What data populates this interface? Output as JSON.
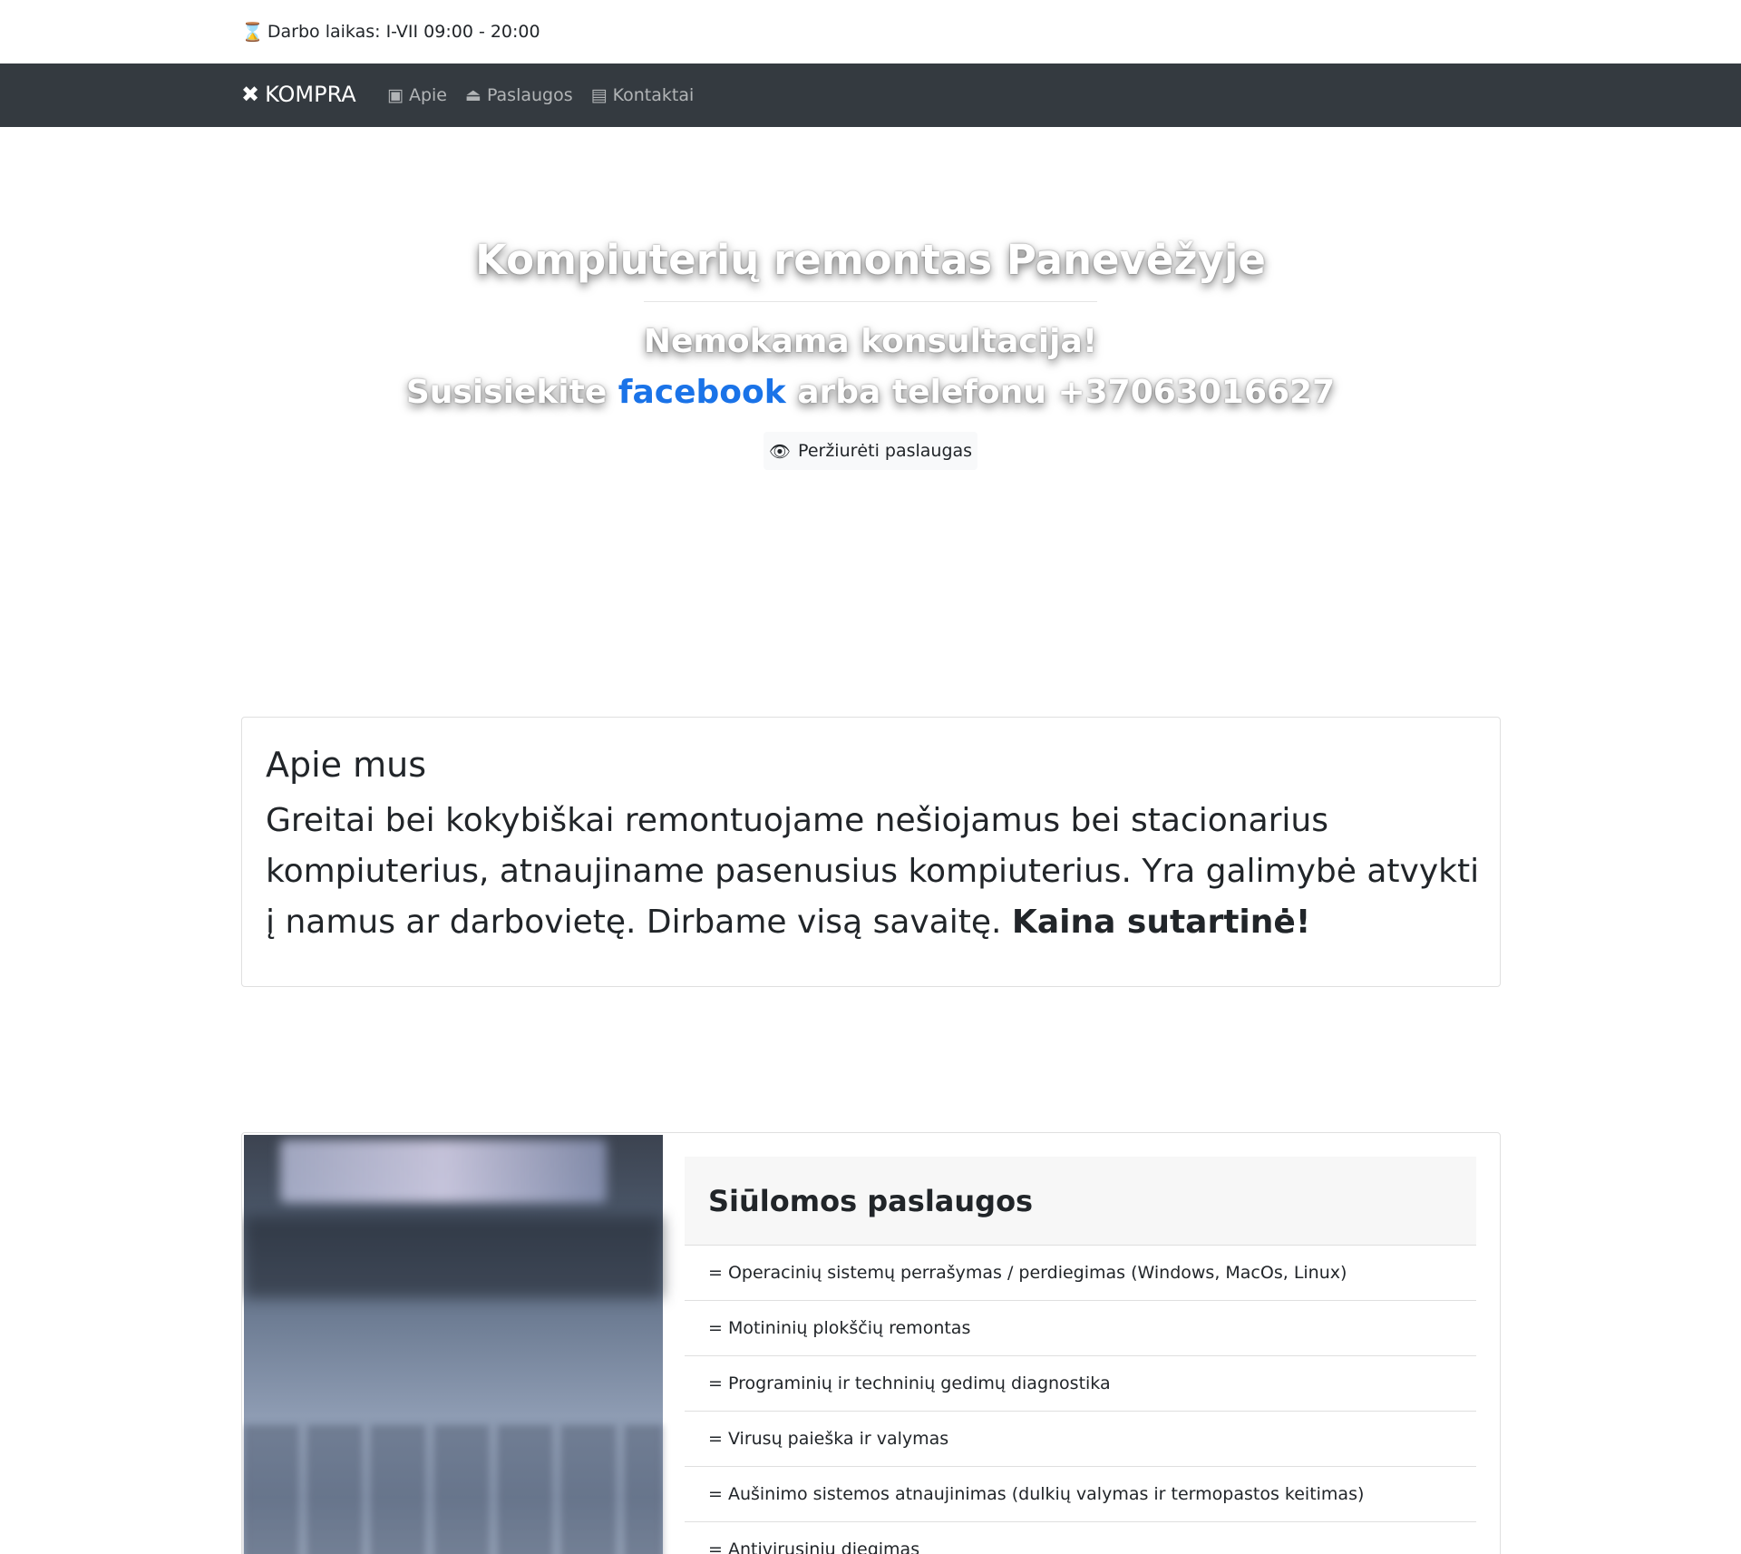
{
  "topbar": {
    "hours_icon": "hourglass-icon",
    "hours_text": "Darbo laikas: I-VII 09:00 - 20:00"
  },
  "navbar": {
    "brand_icon": "tools-icon",
    "brand": "KOMPRA",
    "items": [
      {
        "icon": "id-card-icon",
        "label": "Apie"
      },
      {
        "icon": "service-bell-icon",
        "label": "Paslaugos"
      },
      {
        "icon": "address-book-icon",
        "label": "Kontaktai"
      }
    ],
    "bg_color": "#343a40"
  },
  "hero": {
    "title": "Kompiuterių remontas Panevėžyje",
    "subtitle": "Nemokama konsultacija!",
    "contact_prefix": "Susisiekite",
    "contact_link": "facebook",
    "contact_suffix": "arba telefonu +37063016627",
    "button_icon": "eye-icon",
    "button_label": "Peržiurėti paslaugas",
    "link_color": "#1a73e8"
  },
  "about": {
    "title": "Apie mus",
    "text": "Greitai bei kokybiškai remontuojame nešiojamus bei stacionarius kompiuterius, atnaujiname pasenusius kompiuterius. Yra galimybė atvykti į namus ar darbovietę. Dirbame visą savaitę.",
    "text_bold": "Kaina sutartinė!"
  },
  "services": {
    "title": "Siūlomos paslaugos",
    "items": [
      "= Operacinių sistemų perrašymas / perdiegimas (Windows, MacOs, Linux)",
      "= Motininių plokščių remontas",
      "= Programinių ir techninių gedimų diagnostika",
      "= Virusų paieška ir valymas",
      "= Aušinimo sistemos atnaujinimas (dulkių valymas ir termopastos keitimas)",
      "= Antivirusinių diegimas"
    ]
  }
}
